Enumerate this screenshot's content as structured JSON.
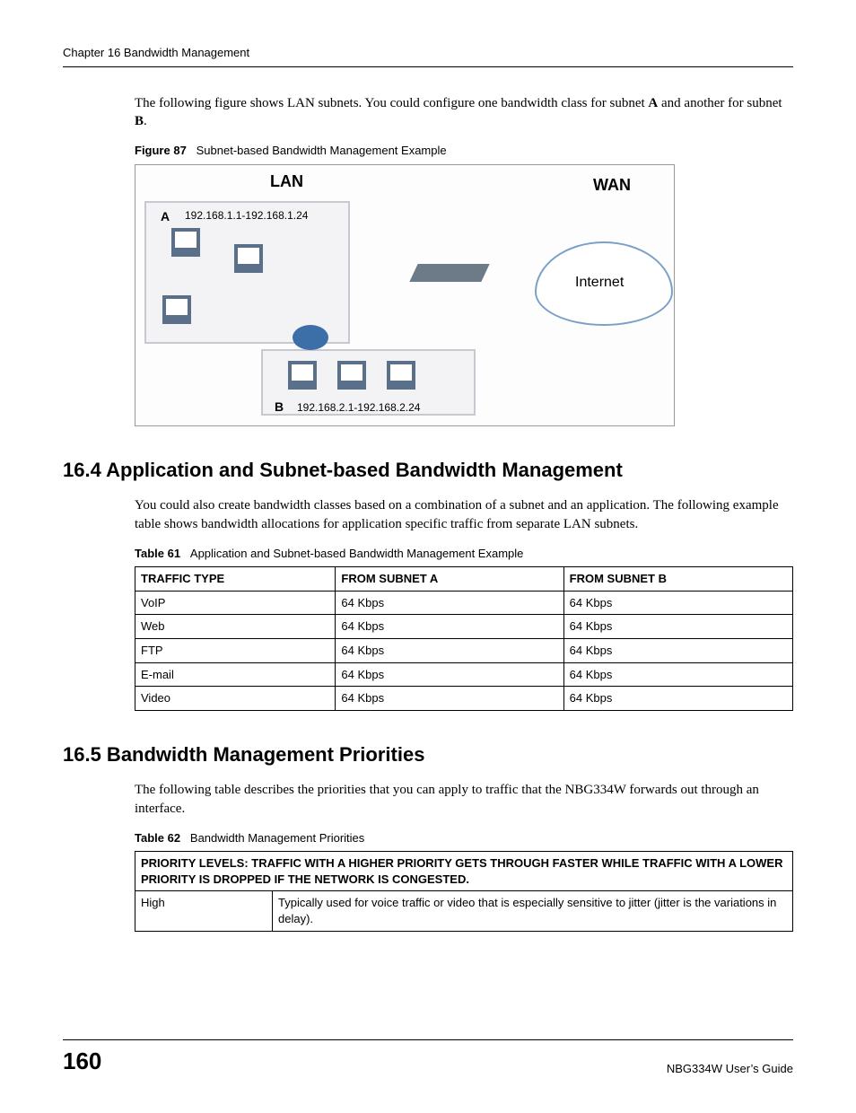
{
  "header": {
    "chapter": "Chapter 16 Bandwidth Management"
  },
  "intro": {
    "text_before_a": "The following figure shows LAN subnets. You could configure one bandwidth class for subnet ",
    "bold_a": "A",
    "text_mid": " and another for subnet ",
    "bold_b": "B",
    "text_after": "."
  },
  "figure87": {
    "label": "Figure 87",
    "title": "Subnet-based Bandwidth Management Example",
    "lan": "LAN",
    "wan": "WAN",
    "a": "A",
    "a_range": "192.168.1.1-192.168.1.24",
    "b": "B",
    "b_range": "192.168.2.1-192.168.2.24",
    "internet": "Internet"
  },
  "section164": {
    "heading": "16.4  Application and Subnet-based Bandwidth Management",
    "text": "You could also create bandwidth classes based on a combination of a subnet and an application. The following example table shows bandwidth allocations for application specific traffic from separate LAN subnets."
  },
  "table61": {
    "label": "Table 61",
    "title": "Application and Subnet-based Bandwidth Management Example",
    "headers": {
      "c1": "TRAFFIC TYPE",
      "c2": "FROM SUBNET A",
      "c3": "FROM SUBNET B"
    },
    "rows": [
      {
        "type": "VoIP",
        "a": "64 Kbps",
        "b": "64 Kbps"
      },
      {
        "type": "Web",
        "a": "64 Kbps",
        "b": "64 Kbps"
      },
      {
        "type": "FTP",
        "a": "64 Kbps",
        "b": "64 Kbps"
      },
      {
        "type": "E-mail",
        "a": "64 Kbps",
        "b": "64 Kbps"
      },
      {
        "type": "Video",
        "a": "64 Kbps",
        "b": "64 Kbps"
      }
    ]
  },
  "section165": {
    "heading": "16.5  Bandwidth Management Priorities",
    "text": "The following table describes the priorities that you can apply to traffic that the NBG334W forwards out through an interface."
  },
  "table62": {
    "label": "Table 62",
    "title": "Bandwidth Management Priorities",
    "header_full": "PRIORITY LEVELS: TRAFFIC WITH A HIGHER PRIORITY GETS THROUGH FASTER WHILE TRAFFIC WITH A LOWER PRIORITY IS DROPPED IF THE NETWORK IS CONGESTED.",
    "rows": [
      {
        "level": "High",
        "desc": "Typically used for voice traffic or video that is especially sensitive to jitter (jitter is the variations in delay)."
      }
    ]
  },
  "footer": {
    "page": "160",
    "guide": "NBG334W User’s Guide"
  }
}
